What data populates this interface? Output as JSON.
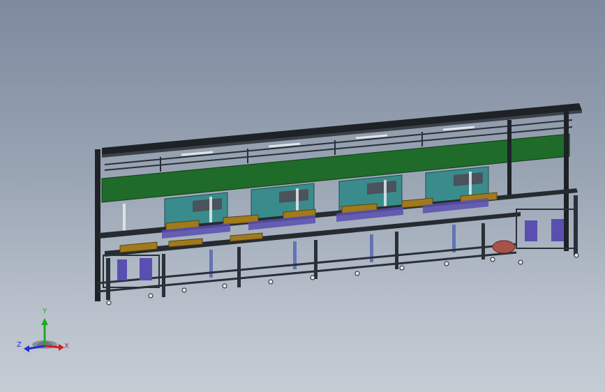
{
  "viewport": {
    "background_top": "#7d8a9e",
    "background_bottom": "#c6ccd4"
  },
  "model": {
    "frame_color": "#1e2227",
    "banner_color": "#1f6b2a",
    "enclosure_color": "#3a8c8c",
    "conveyor_color": "#a07a1c",
    "fixture_color": "#5a4fb0",
    "motor_color": "#a8524a"
  },
  "triad": {
    "x_label": "X",
    "y_label": "Y",
    "z_label": "Z",
    "x_color": "#d42020",
    "y_color": "#1faa1f",
    "z_color": "#2030d4"
  }
}
